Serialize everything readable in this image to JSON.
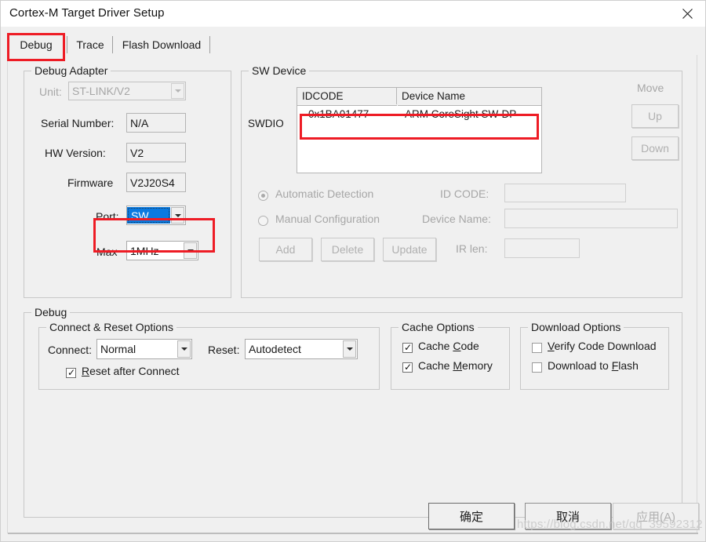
{
  "window": {
    "title": "Cortex-M Target Driver Setup",
    "close_icon": "close-icon"
  },
  "tabs": [
    {
      "label": "Debug",
      "selected": true
    },
    {
      "label": "Trace",
      "selected": false
    },
    {
      "label": "Flash Download",
      "selected": false
    }
  ],
  "debug_adapter": {
    "title": "Debug Adapter",
    "unit": {
      "label": "Unit:",
      "value": "ST-LINK/V2",
      "disabled": true
    },
    "serial_number": {
      "label": "Serial Number:",
      "value": "N/A"
    },
    "hw_version": {
      "label": "HW Version:",
      "value": "V2"
    },
    "firmware": {
      "label": "Firmware",
      "value": "V2J20S4"
    },
    "port": {
      "label": "Port:",
      "value": "SW",
      "highlighted": true
    },
    "max": {
      "label": "Max",
      "value": "1MHz"
    }
  },
  "sw_device": {
    "title": "SW Device",
    "swdio_label": "SWDIO",
    "columns": [
      "IDCODE",
      "Device Name",
      ""
    ],
    "rows": [
      {
        "idcode": "0x1BA01477",
        "device_name": "ARM CoreSight SW-DP"
      }
    ],
    "move_label": "Move",
    "up_label": "Up",
    "down_label": "Down",
    "automatic_detection": {
      "label": "Automatic Detection",
      "checked": true,
      "disabled": true
    },
    "manual_configuration": {
      "label": "Manual Configuration",
      "checked": false,
      "disabled": true
    },
    "id_code": {
      "label": "ID CODE:",
      "value": ""
    },
    "device_name": {
      "label": "Device Name:",
      "value": ""
    },
    "ir_len": {
      "label": "IR len:",
      "value": ""
    },
    "add_label": "Add",
    "delete_label": "Delete",
    "update_label": "Update"
  },
  "debug_section": {
    "title": "Debug",
    "connect_reset": {
      "title": "Connect & Reset Options",
      "connect": {
        "label": "Connect:",
        "value": "Normal"
      },
      "reset": {
        "label": "Reset:",
        "value": "Autodetect"
      },
      "reset_after_connect": {
        "label_pre": "",
        "label_accel": "R",
        "label_post": "eset after Connect",
        "checked": true
      }
    },
    "cache_options": {
      "title": "Cache Options",
      "cache_code": {
        "pre": "Cache ",
        "accel": "C",
        "post": "ode",
        "checked": true
      },
      "cache_memory": {
        "pre": "Cache ",
        "accel": "M",
        "post": "emory",
        "checked": true
      }
    },
    "download_options": {
      "title": "Download Options",
      "verify_code_download": {
        "pre": "",
        "accel": "V",
        "post": "erify Code Download",
        "checked": false
      },
      "download_to_flash": {
        "pre": "Download to ",
        "accel": "F",
        "post": "lash",
        "checked": false
      }
    }
  },
  "footer": {
    "ok_label": "确定",
    "cancel_label": "取消",
    "apply_label": "应用(A)"
  },
  "watermark": "https://blog.csdn.net/qq_39592312",
  "colors": {
    "annotation_red": "#ee1c25",
    "selection_blue": "#0a7ae0",
    "dialog_bg": "#f0f0f0"
  }
}
